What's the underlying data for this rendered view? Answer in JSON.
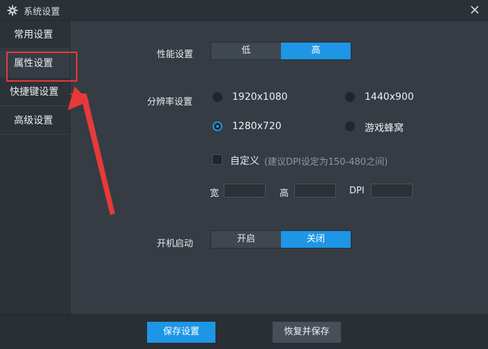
{
  "window": {
    "title": "系统设置",
    "icons": {
      "title": "gear-icon",
      "close": "close-icon"
    }
  },
  "sidebar": {
    "items": [
      {
        "label": "常用设置",
        "active": false
      },
      {
        "label": "属性设置",
        "active": true
      },
      {
        "label": "快捷键设置",
        "active": false
      },
      {
        "label": "高级设置",
        "active": false
      }
    ]
  },
  "performance": {
    "label": "性能设置",
    "options": [
      "低",
      "高"
    ],
    "selected": "高"
  },
  "resolution": {
    "label": "分辨率设置",
    "options": [
      "1920x1080",
      "1440x900",
      "1280x720",
      "游戏蜂窝"
    ],
    "selected": "1280x720"
  },
  "custom": {
    "label": "自定义",
    "hint": "(建议DPI设定为150-480之间)",
    "checked": false,
    "width_label": "宽",
    "height_label": "高",
    "dpi_label": "DPI",
    "width_value": "",
    "height_value": "",
    "dpi_value": ""
  },
  "autostart": {
    "label": "开机启动",
    "options": [
      "开启",
      "关闭"
    ],
    "selected": "关闭"
  },
  "footer": {
    "save": "保存设置",
    "restore": "恢复并保存"
  },
  "colors": {
    "accent": "#1e96e6",
    "annotation": "#e8393a"
  }
}
